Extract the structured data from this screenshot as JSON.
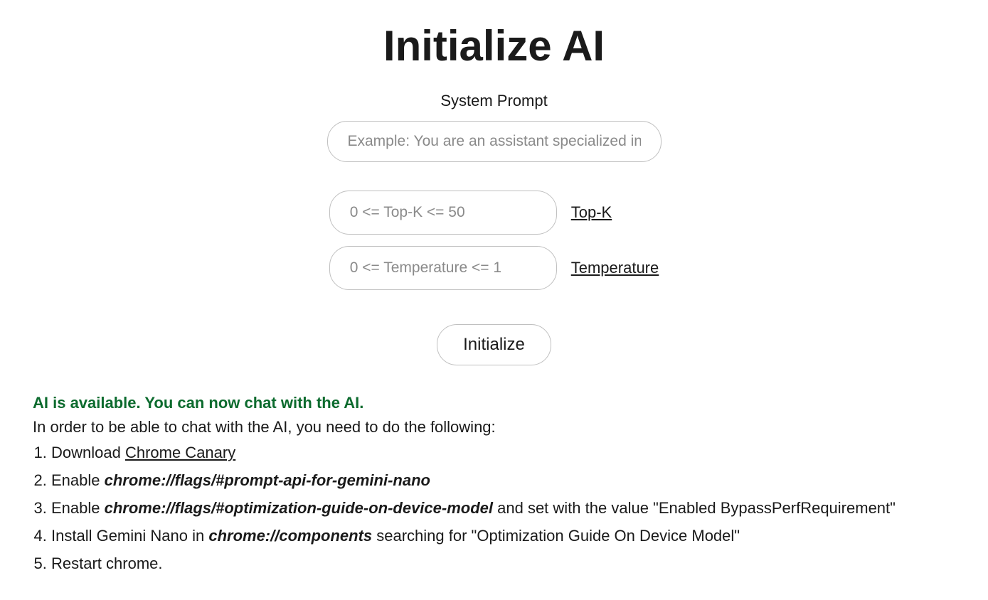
{
  "title": "Initialize AI",
  "systemPrompt": {
    "label": "System Prompt",
    "placeholder": "Example: You are an assistant specialized in cl"
  },
  "params": {
    "topk": {
      "placeholder": "0 <= Top-K <= 50",
      "linkLabel": "Top-K"
    },
    "temperature": {
      "placeholder": "0 <= Temperature <= 1",
      "linkLabel": "Temperature"
    }
  },
  "initButton": "Initialize",
  "status": "AI is available. You can now chat with the AI.",
  "instructions": {
    "intro": "In order to be able to chat with the AI, you need to do the following:",
    "steps": {
      "s1_pre": "Download ",
      "s1_link": "Chrome Canary",
      "s2_pre": "Enable ",
      "s2_flag": "chrome://flags/#prompt-api-for-gemini-nano",
      "s3_pre": "Enable ",
      "s3_flag": "chrome://flags/#optimization-guide-on-device-model",
      "s3_post": " and set with the value \"Enabled BypassPerfRequirement\"",
      "s4_pre": "Install Gemini Nano in ",
      "s4_flag": "chrome://components",
      "s4_post": " searching for \"Optimization Guide On Device Model\"",
      "s5": "Restart chrome."
    }
  }
}
